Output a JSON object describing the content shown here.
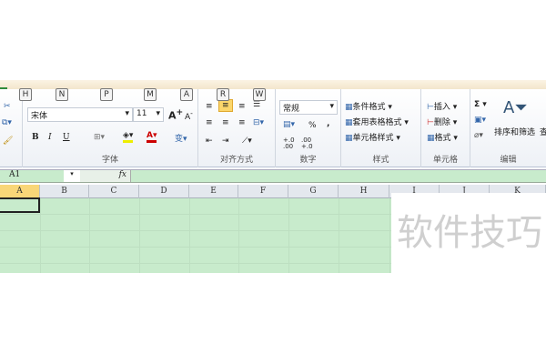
{
  "keytips": [
    "H",
    "N",
    "P",
    "M",
    "A",
    "R",
    "W"
  ],
  "font": {
    "name": "宋体",
    "size": "11",
    "bold": "B",
    "italic": "I",
    "underline": "U",
    "label": "字体"
  },
  "alignment": {
    "label": "对齐方式"
  },
  "number": {
    "format": "常规",
    "percent": "%",
    "comma": ",",
    "inc_decimal": "+.0 .00",
    "dec_decimal": ".00 +.0",
    "label": "数字"
  },
  "styles": {
    "conditional": "条件格式",
    "table": "套用表格格式",
    "cell": "单元格样式",
    "label": "样式"
  },
  "cells": {
    "insert": "插入",
    "delete": "删除",
    "format": "格式",
    "label": "单元格"
  },
  "editing": {
    "sum": "Σ",
    "sort_filter": "排序和筛选",
    "find": "查",
    "label": "编辑"
  },
  "formula_bar": {
    "name_box": "A1",
    "fx": "fx"
  },
  "columns": [
    "A",
    "B",
    "C",
    "D",
    "E",
    "F",
    "G",
    "H",
    "I",
    "J",
    "K"
  ],
  "watermark": "软件技巧"
}
